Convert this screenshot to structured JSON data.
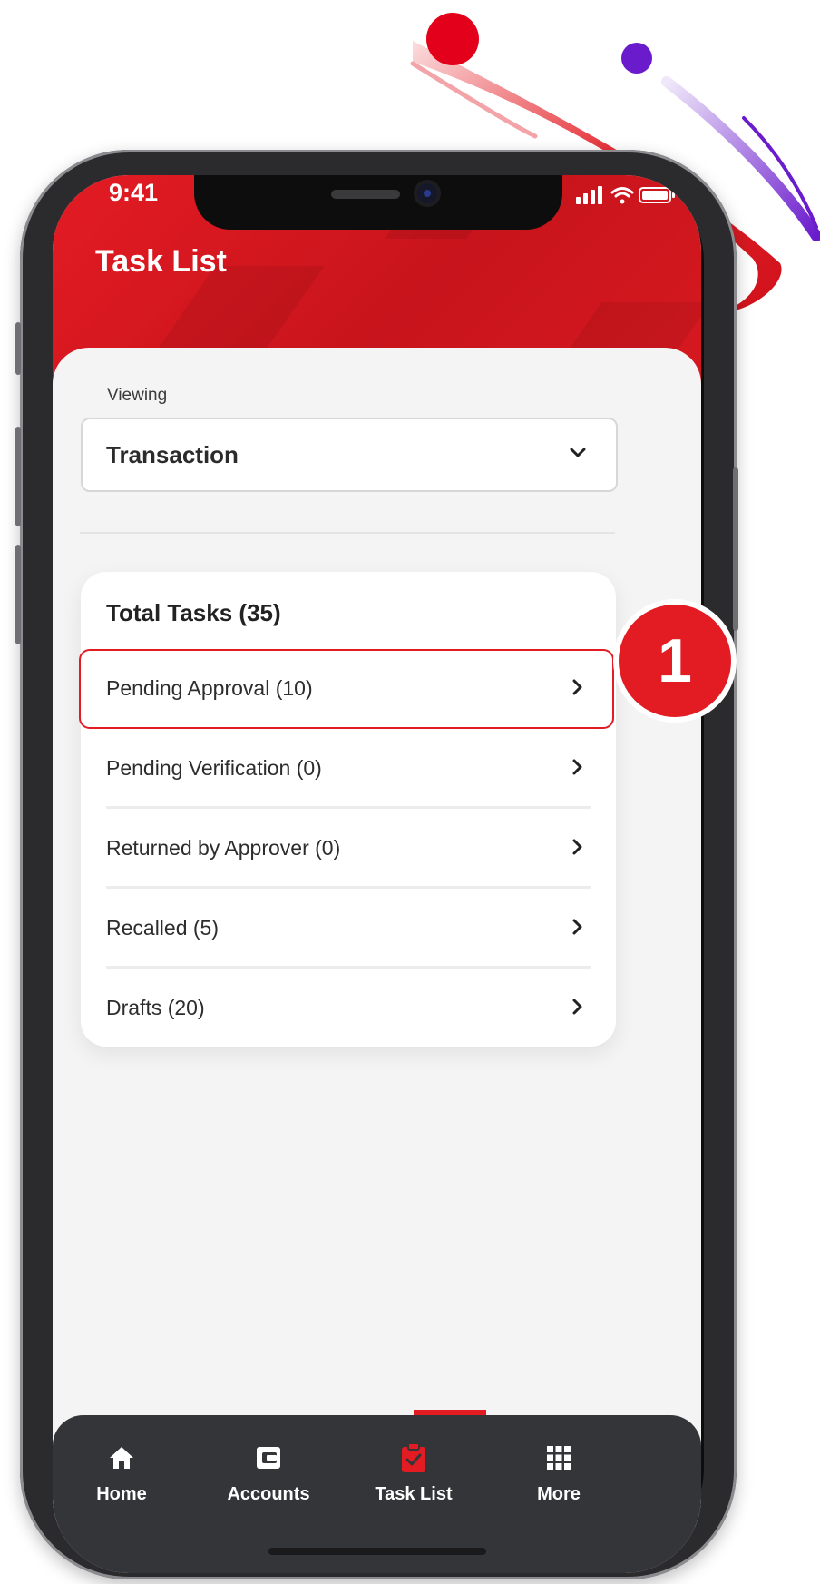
{
  "status_bar": {
    "time": "9:41"
  },
  "header": {
    "title": "Task List"
  },
  "viewing": {
    "label": "Viewing",
    "selected": "Transaction"
  },
  "tasks": {
    "title": "Total Tasks (35)",
    "items": [
      {
        "label": "Pending Approval (10)"
      },
      {
        "label": "Pending Verification (0)"
      },
      {
        "label": "Returned by Approver (0)"
      },
      {
        "label": "Recalled (5)"
      },
      {
        "label": "Drafts (20)"
      }
    ]
  },
  "tabbar": {
    "items": [
      {
        "label": "Home",
        "icon": "home-icon"
      },
      {
        "label": "Accounts",
        "icon": "wallet-icon"
      },
      {
        "label": "Task List",
        "icon": "clipboard-check-icon",
        "active": true
      },
      {
        "label": "More",
        "icon": "grid-icon"
      }
    ]
  },
  "annotation": {
    "step": "1"
  },
  "colors": {
    "brand_red": "#e31b23",
    "tab_bar": "#343539",
    "accent_purple": "#6a1bcc"
  }
}
